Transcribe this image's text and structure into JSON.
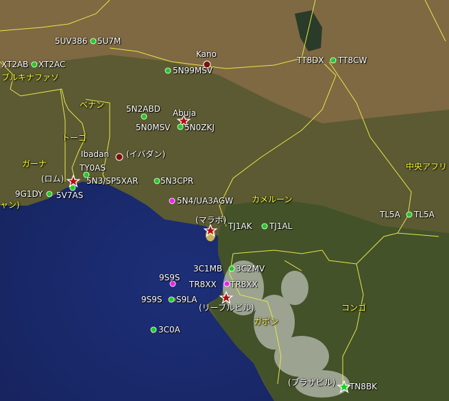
{
  "colors": {
    "ocean": "#1b2a6b",
    "land": "#5a5a2e",
    "border": "#e8e84a",
    "station_green": "#22cc22",
    "station_magenta": "#ee22ee",
    "city_red": "#7a1010",
    "label_white": "#ffffff",
    "label_yellow": "#ffff33"
  },
  "countries": {
    "burkina": "ブルキナファソ",
    "benin": "ベナン",
    "togo": "トーゴ",
    "ghana": "ガーナ",
    "cameroon": "カメルーン",
    "central_africa": "中央アフリ",
    "gabon": "ガボン",
    "congo": "コンゴ",
    "ivory_fragment": "ャン)"
  },
  "cities": {
    "kano": "Kano",
    "abuja": "Abuja",
    "ibadan": "Ibadan",
    "ibadan_jp": "(イバダン)",
    "lome": "(ロム)",
    "malabo": "(マラボ)",
    "libreville": "(リーブルビル)",
    "brazzaville": "(ブラザビル)"
  },
  "stations": {
    "s5uv386": "5UV386",
    "s5u7m": "5U7M",
    "xt2ab": "XT2AB",
    "xt2ac": "XT2AC",
    "s5n99msv": "5N99MSV",
    "tt8dx": "TT8DX",
    "tt8cw": "TT8CW",
    "s5n2abd": "5N2ABD",
    "s5n0msv": "5N0MSV",
    "s5n0zkj": "5N0ZKJ",
    "ty0as": "TY0AS",
    "s5n3sp5xar": "5N3/SP5XAR",
    "s5n3cpr": "5N3CPR",
    "s9g1dy": "9G1DY",
    "s5v7as": "5V7AS",
    "s5n4ua3agw": "5N4/UA3AGW",
    "tj1ak": "TJ1AK",
    "tj1al": "TJ1AL",
    "tl5a_l": "TL5A",
    "tl5a_r": "TL5A",
    "s3c1mb": "3C1MB",
    "s3c2mv": "3C2MV",
    "s9ss_a": "9S9S",
    "tr8xx_l": "TR8XX",
    "tr8xx_r": "TR8XX",
    "s9ss_b": "9S9S",
    "s9la": "S9LA",
    "s3c0a": "3C0A",
    "tn8bk": "TN8BK"
  }
}
